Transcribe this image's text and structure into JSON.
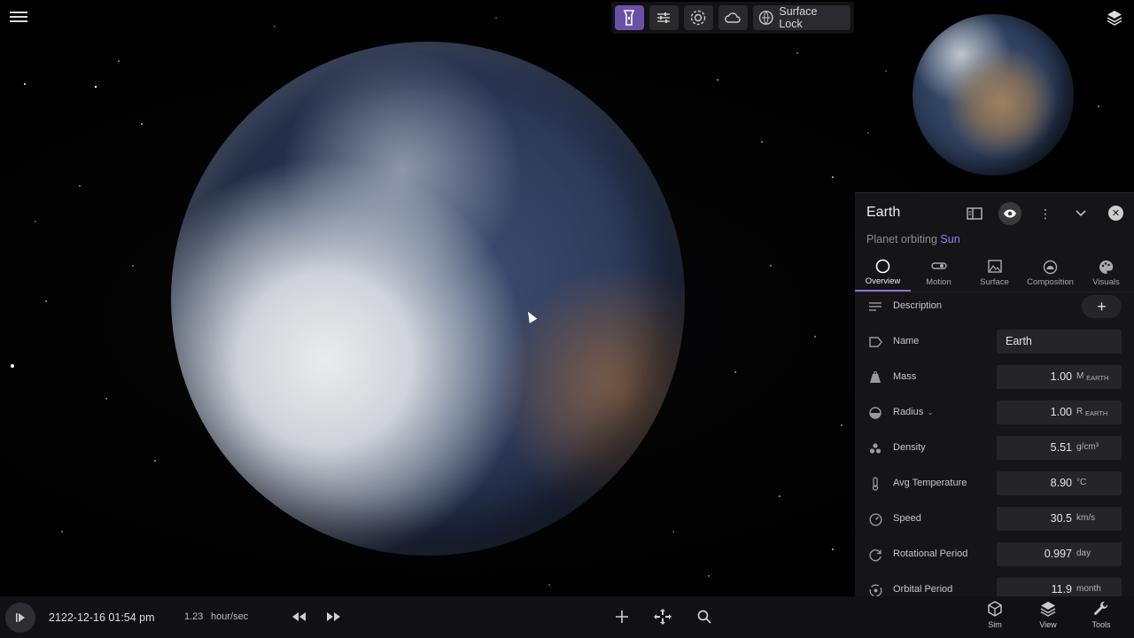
{
  "toolbar": {
    "surface_lock_label": "Surface Lock",
    "accent_color": "#6a51a8"
  },
  "panel": {
    "title": "Earth",
    "subtitle_prefix": "Planet orbiting",
    "subtitle_link": "Sun",
    "tabs": [
      {
        "label": "Overview",
        "icon": "circle-icon",
        "active": true
      },
      {
        "label": "Motion",
        "icon": "motion-icon",
        "active": false
      },
      {
        "label": "Surface",
        "icon": "surface-icon",
        "active": false
      },
      {
        "label": "Composition",
        "icon": "composition-icon",
        "active": false
      },
      {
        "label": "Visuals",
        "icon": "palette-icon",
        "active": false
      }
    ],
    "rows": {
      "description": {
        "label": "Description"
      },
      "name": {
        "label": "Name",
        "value": "Earth"
      },
      "mass": {
        "label": "Mass",
        "value": "1.00",
        "unit": "M",
        "unit_sub": "EARTH"
      },
      "radius": {
        "label": "Radius",
        "value": "1.00",
        "unit": "R",
        "unit_sub": "EARTH"
      },
      "density": {
        "label": "Density",
        "value": "5.51",
        "unit": "g/cm³"
      },
      "avg_temperature": {
        "label": "Avg Temperature",
        "value": "8.90",
        "unit": "°C"
      },
      "speed": {
        "label": "Speed",
        "value": "30.5",
        "unit": "km/s"
      },
      "rotational_period": {
        "label": "Rotational Period",
        "value": "0.997",
        "unit": "day"
      },
      "orbital_period": {
        "label": "Orbital Period",
        "value": "11.9",
        "unit": "month"
      }
    }
  },
  "bottom": {
    "date": "2122-12-16 01:54 pm",
    "rate_value": "1.23",
    "rate_unit": "hour/sec",
    "nav": [
      {
        "label": "Sim",
        "icon": "cube-icon"
      },
      {
        "label": "View",
        "icon": "layers-icon"
      },
      {
        "label": "Tools",
        "icon": "wrench-icon"
      }
    ]
  }
}
